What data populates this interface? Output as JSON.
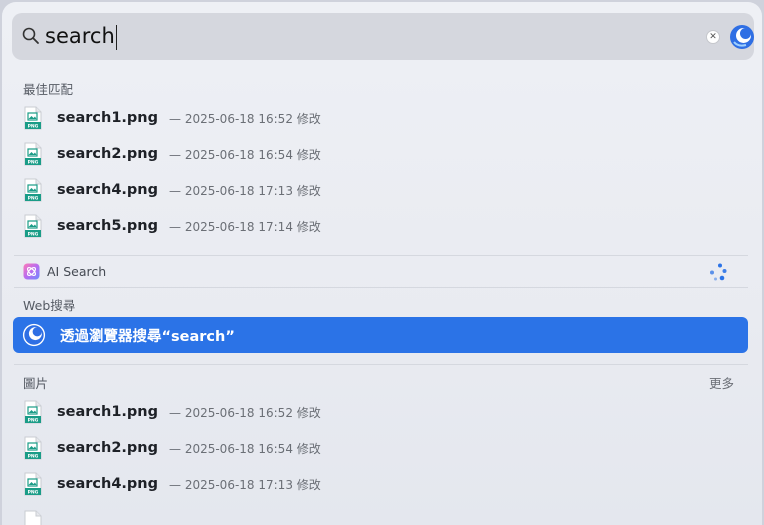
{
  "search": {
    "query": "search"
  },
  "sections": {
    "best_match": "最佳匹配",
    "ai_search": "AI Search",
    "web_search": "Web搜尋",
    "images": "圖片",
    "more": "更多"
  },
  "best_match_items": [
    {
      "name": "search1.png",
      "meta": "— 2025-06-18 16:52 修改"
    },
    {
      "name": "search2.png",
      "meta": "— 2025-06-18 16:54 修改"
    },
    {
      "name": "search4.png",
      "meta": "— 2025-06-18 17:13 修改"
    },
    {
      "name": "search5.png",
      "meta": "— 2025-06-18 17:14 修改"
    }
  ],
  "web_item": {
    "label": "透過瀏覽器搜尋“search”"
  },
  "image_items": [
    {
      "name": "search1.png",
      "meta": "— 2025-06-18 16:52 修改"
    },
    {
      "name": "search2.png",
      "meta": "— 2025-06-18 16:54 修改"
    },
    {
      "name": "search4.png",
      "meta": "— 2025-06-18 17:13 修改"
    }
  ],
  "file_icon_text": "PNG",
  "colors": {
    "accent": "#2b73e7",
    "file_icon": "#1a9c87"
  }
}
